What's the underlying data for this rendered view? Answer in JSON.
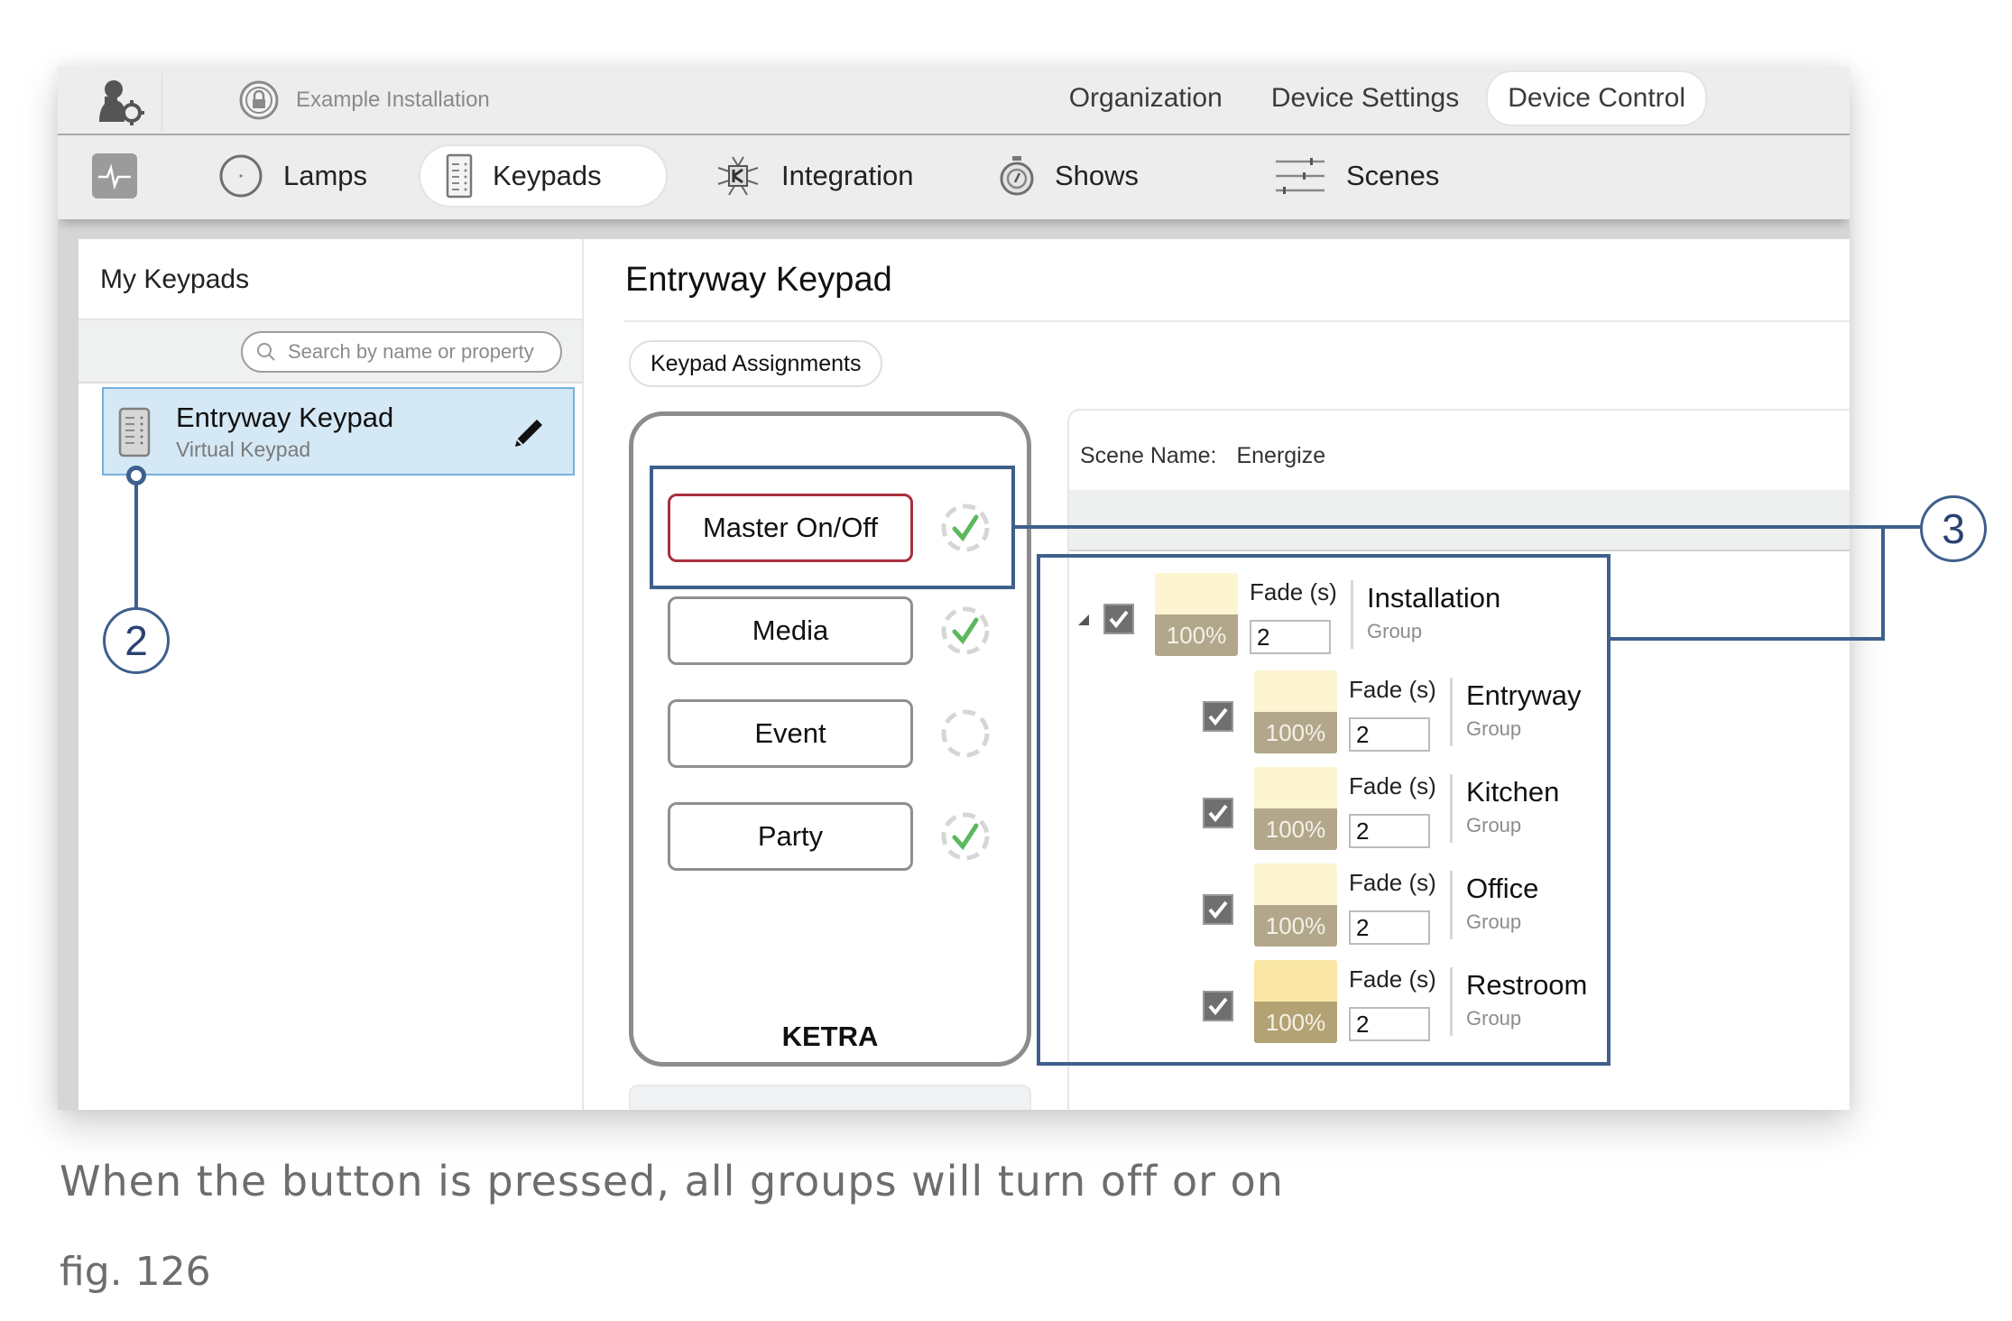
{
  "topbar": {
    "installation_name": "Example Installation",
    "tabs": [
      {
        "label": "Organization",
        "active": false
      },
      {
        "label": "Device Settings",
        "active": false
      },
      {
        "label": "Device Control",
        "active": true
      }
    ]
  },
  "navbar": {
    "items": [
      {
        "label": "Lamps",
        "icon": "lamp-icon",
        "active": false
      },
      {
        "label": "Keypads",
        "icon": "keypad-icon",
        "active": true
      },
      {
        "label": "Integration",
        "icon": "integration-icon",
        "active": false
      },
      {
        "label": "Shows",
        "icon": "stopwatch-icon",
        "active": false
      },
      {
        "label": "Scenes",
        "icon": "sliders-icon",
        "active": false
      }
    ]
  },
  "left_panel": {
    "title": "My Keypads",
    "search_placeholder": "Search by name or property",
    "keypads": [
      {
        "name": "Entryway Keypad",
        "type": "Virtual Keypad",
        "selected": true
      }
    ]
  },
  "main": {
    "title": "Entryway Keypad",
    "assignments_button": "Keypad Assignments",
    "keypad": {
      "brand": "KETRA",
      "buttons": [
        {
          "label": "Master On/Off",
          "selected": true,
          "assigned": true
        },
        {
          "label": "Media",
          "selected": false,
          "assigned": true
        },
        {
          "label": "Event",
          "selected": false,
          "assigned": false
        },
        {
          "label": "Party",
          "selected": false,
          "assigned": true
        }
      ]
    },
    "scene": {
      "name_label": "Scene Name:",
      "name_value": "Energize",
      "groups": [
        {
          "name": "Installation",
          "type": "Group",
          "level": "100%",
          "fade_label": "Fade (s)",
          "fade": "2",
          "checked": true,
          "expanded": true
        },
        {
          "name": "Entryway",
          "type": "Group",
          "level": "100%",
          "fade_label": "Fade (s)",
          "fade": "2",
          "checked": true
        },
        {
          "name": "Kitchen",
          "type": "Group",
          "level": "100%",
          "fade_label": "Fade (s)",
          "fade": "2",
          "checked": true
        },
        {
          "name": "Office",
          "type": "Group",
          "level": "100%",
          "fade_label": "Fade (s)",
          "fade": "2",
          "checked": true
        },
        {
          "name": "Restroom",
          "type": "Group",
          "level": "100%",
          "fade_label": "Fade (s)",
          "fade": "2",
          "checked": true
        }
      ]
    }
  },
  "annotations": {
    "callout_2": "2",
    "callout_3": "3",
    "color": "#3f5f8c"
  },
  "caption": {
    "text": "When the button is pressed, all groups will turn off or on",
    "figure": "fig. 126"
  },
  "colors": {
    "selected_button_border": "#a8303f",
    "selected_list_item": "#d4e8f5",
    "check_green": "#5cb85c",
    "level_swatch": "#fdf4d2"
  }
}
